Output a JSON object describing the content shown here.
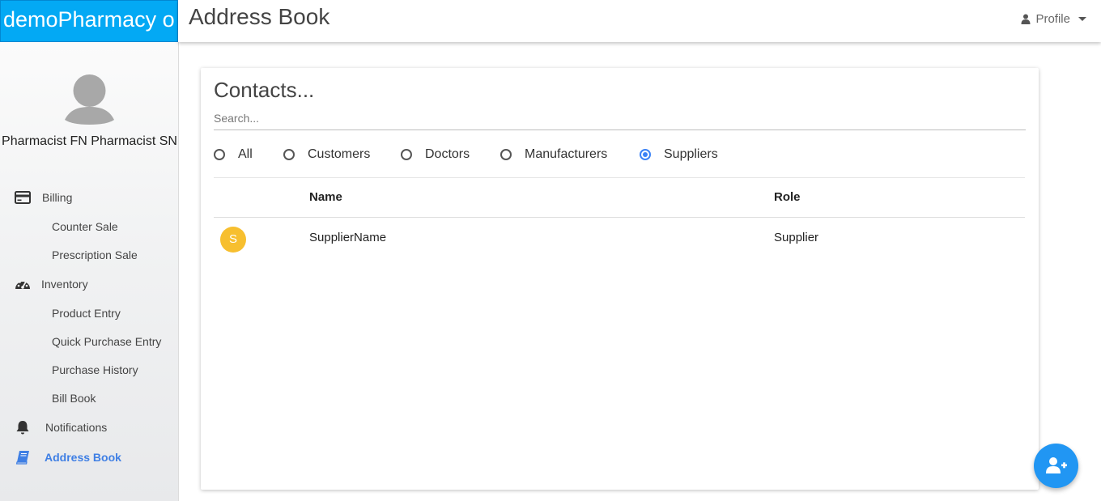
{
  "brand": {
    "title": "demoPharmacy o"
  },
  "header": {
    "title": "Address Book",
    "profile_label": "Profile",
    "profile_icon": "user-icon"
  },
  "sidebar": {
    "user_name": "Pharmacist FN Pharmacist SN",
    "sections": [
      {
        "label": "Billing",
        "icon": "credit-card-icon",
        "children": [
          "Counter Sale",
          "Prescription Sale"
        ]
      },
      {
        "label": "Inventory",
        "icon": "dashboard-gauge-icon",
        "children": [
          "Product Entry",
          "Quick Purchase Entry",
          "Purchase History",
          "Bill Book"
        ]
      },
      {
        "label": "Notifications",
        "icon": "bell-icon",
        "children": []
      },
      {
        "label": "Address Book",
        "icon": "book-icon",
        "children": [],
        "active": true
      }
    ]
  },
  "contacts": {
    "title": "Contacts...",
    "search": {
      "placeholder": "Search...",
      "value": ""
    },
    "filters": [
      {
        "label": "All",
        "checked": false
      },
      {
        "label": "Customers",
        "checked": false
      },
      {
        "label": "Doctors",
        "checked": false
      },
      {
        "label": "Manufacturers",
        "checked": false
      },
      {
        "label": "Suppliers",
        "checked": true
      }
    ],
    "columns": [
      "Name",
      "Role"
    ],
    "rows": [
      {
        "initial": "S",
        "name": "SupplierName",
        "role": "Supplier",
        "avatar_color": "#f7bf2f"
      }
    ]
  },
  "fab": {
    "icon": "add-user-icon",
    "color": "#2196f3"
  },
  "colors": {
    "brand": "#03a9f4",
    "accent": "#3f7fe4"
  }
}
